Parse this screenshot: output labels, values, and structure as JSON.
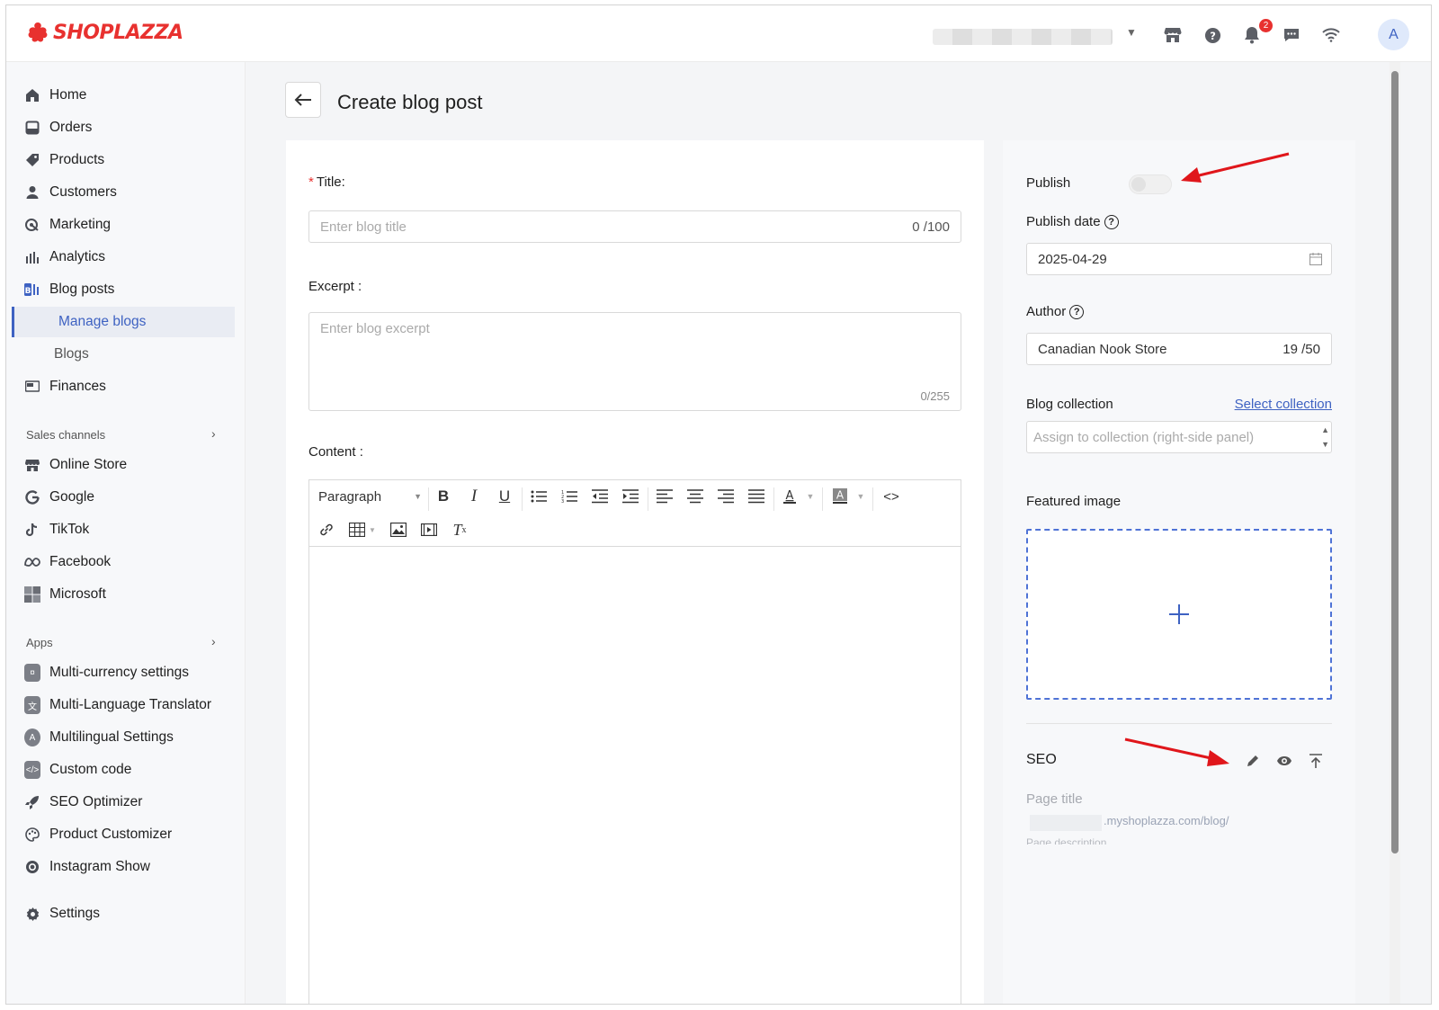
{
  "header": {
    "logo_text": "SHOPLAZZA",
    "notification_count": "2",
    "avatar_initial": "A",
    "icons": [
      "storefront-icon",
      "help-icon",
      "bell-icon",
      "message-icon",
      "wifi-icon"
    ]
  },
  "sidebar": {
    "items": [
      {
        "label": "Home",
        "icon": "home-icon"
      },
      {
        "label": "Orders",
        "icon": "orders-icon"
      },
      {
        "label": "Products",
        "icon": "tag-icon"
      },
      {
        "label": "Customers",
        "icon": "person-icon"
      },
      {
        "label": "Marketing",
        "icon": "marketing-icon"
      },
      {
        "label": "Analytics",
        "icon": "bar-chart-icon"
      },
      {
        "label": "Blog posts",
        "icon": "blog-icon"
      },
      {
        "label": "Manage blogs"
      },
      {
        "label": "Blogs"
      },
      {
        "label": "Finances",
        "icon": "finance-icon"
      }
    ],
    "sales_channels_heading": "Sales channels",
    "channels": [
      {
        "label": "Online Store"
      },
      {
        "label": "Google"
      },
      {
        "label": "TikTok"
      },
      {
        "label": "Facebook"
      },
      {
        "label": "Microsoft"
      }
    ],
    "apps_heading": "Apps",
    "apps": [
      {
        "label": "Multi-currency settings"
      },
      {
        "label": "Multi-Language Translator"
      },
      {
        "label": "Multilingual Settings"
      },
      {
        "label": "Custom code"
      },
      {
        "label": "SEO Optimizer"
      },
      {
        "label": "Product Customizer"
      },
      {
        "label": "Instagram Show"
      }
    ],
    "settings_label": "Settings"
  },
  "page": {
    "title": "Create blog post"
  },
  "form": {
    "title_label": "Title",
    "title_sep": ":",
    "title_placeholder": "Enter blog title",
    "title_counter": "0 /100",
    "excerpt_label": "Excerpt :",
    "excerpt_placeholder": "Enter blog excerpt",
    "excerpt_counter": "0/255",
    "content_label": "Content :",
    "paragraph_select": "Paragraph"
  },
  "side": {
    "publish_label": "Publish",
    "publish_enabled": false,
    "publish_date_label": "Publish date",
    "publish_date": "2025-04-29",
    "author_label": "Author",
    "author_value": "Canadian Nook Store",
    "author_counter": "19 /50",
    "collection_label": "Blog collection",
    "select_collection": "Select collection",
    "collection_placeholder": "Assign to collection (right-side panel)",
    "featured_image_label": "Featured image",
    "seo_label": "SEO",
    "seo_page_title": "Page title",
    "seo_url": ".myshoplazza.com/blog/",
    "seo_page_description": "Page description"
  },
  "colors": {
    "brand": "#e8312f",
    "accent": "#3e62c2",
    "annotation_arrow": "#e0161b"
  }
}
